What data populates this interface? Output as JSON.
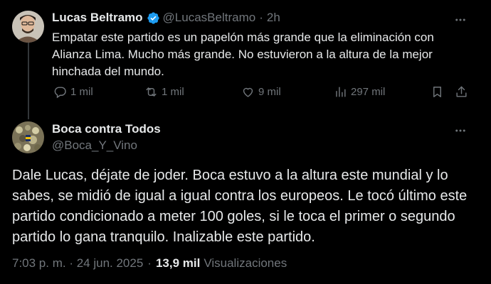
{
  "reply_tweet": {
    "author": {
      "name": "Lucas Beltramo",
      "handle": "@LucasBeltramo",
      "verified": true
    },
    "time": "2h",
    "text": "Empatar este partido es un papelón más grande que la eliminación con Alianza Lima. Mucho más grande. No estuvieron a la altura de la mejor hinchada del mundo.",
    "stats": {
      "replies": "1 mil",
      "retweets": "1 mil",
      "likes": "9 mil",
      "views": "297 mil"
    }
  },
  "main_tweet": {
    "author": {
      "name": "Boca contra Todos",
      "handle": "@Boca_Y_Vino"
    },
    "text": "Dale Lucas, déjate de joder. Boca estuvo a la altura este mundial y lo sabes, se midió de igual a igual contra los europeos. Le tocó último este partido condicionado a meter 100 goles, si le toca el primer o segundo partido lo gana tranquilo. Inalizable este partido.",
    "timestamp": "7:03 p. m. · 24 jun. 2025",
    "views_count": "13,9 mil",
    "views_label": "Visualizaciones"
  },
  "colors": {
    "background": "#000000",
    "text": "#e7e9ea",
    "muted": "#71767b",
    "verified": "#1d9bf0",
    "thread_line": "#333639"
  },
  "icons": [
    "verified-badge-icon",
    "more-icon",
    "reply-icon",
    "retweet-icon",
    "like-icon",
    "views-icon",
    "bookmark-icon",
    "share-icon"
  ]
}
